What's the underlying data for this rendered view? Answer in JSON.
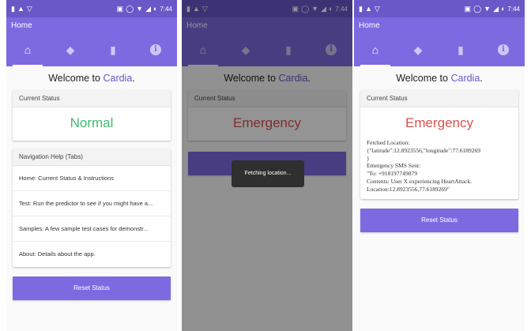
{
  "status_bar": {
    "time": "7:44"
  },
  "app_bar": {
    "title": "Home"
  },
  "tabs": [
    {
      "icon": "home-icon",
      "active": true
    },
    {
      "icon": "tag-icon",
      "active": false
    },
    {
      "icon": "bookmark-icon",
      "active": false
    },
    {
      "icon": "info-icon",
      "active": false
    }
  ],
  "welcome": {
    "prefix": "Welcome to ",
    "brand": "Cardia",
    "suffix": "."
  },
  "status_card": {
    "header": "Current Status"
  },
  "screen1": {
    "status_value": "Normal",
    "nav_help": {
      "header": "Navigation Help (Tabs)",
      "items": [
        "Home: Current Status & Instructions",
        "Test: Run the predictor to see if you might have a...",
        "Samples: A few sample test cases for demonstr...",
        "About: Details about the app."
      ]
    },
    "reset_label": "Reset Status"
  },
  "screen2": {
    "status_value": "Emergency",
    "toast": "Fetching location..."
  },
  "screen3": {
    "status_value": "Emergency",
    "details": {
      "line1": "Fetched Location:",
      "line2": "{\"latitude\":12.8923556,\"longitude\":77.6189269",
      "line3": "}",
      "line4": "Emergency SMS Sent:",
      "line5": "\"To: +918197749879",
      "line6": "Contents: User X experiencing HeartAttack.",
      "line7": "Location:12.8923556,77.6189269\""
    },
    "reset_label": "Reset Status"
  },
  "colors": {
    "accent": "#7e6ae0",
    "status_bar": "#6a58c9",
    "normal": "#3dbb6c",
    "emergency": "#d9534f"
  }
}
